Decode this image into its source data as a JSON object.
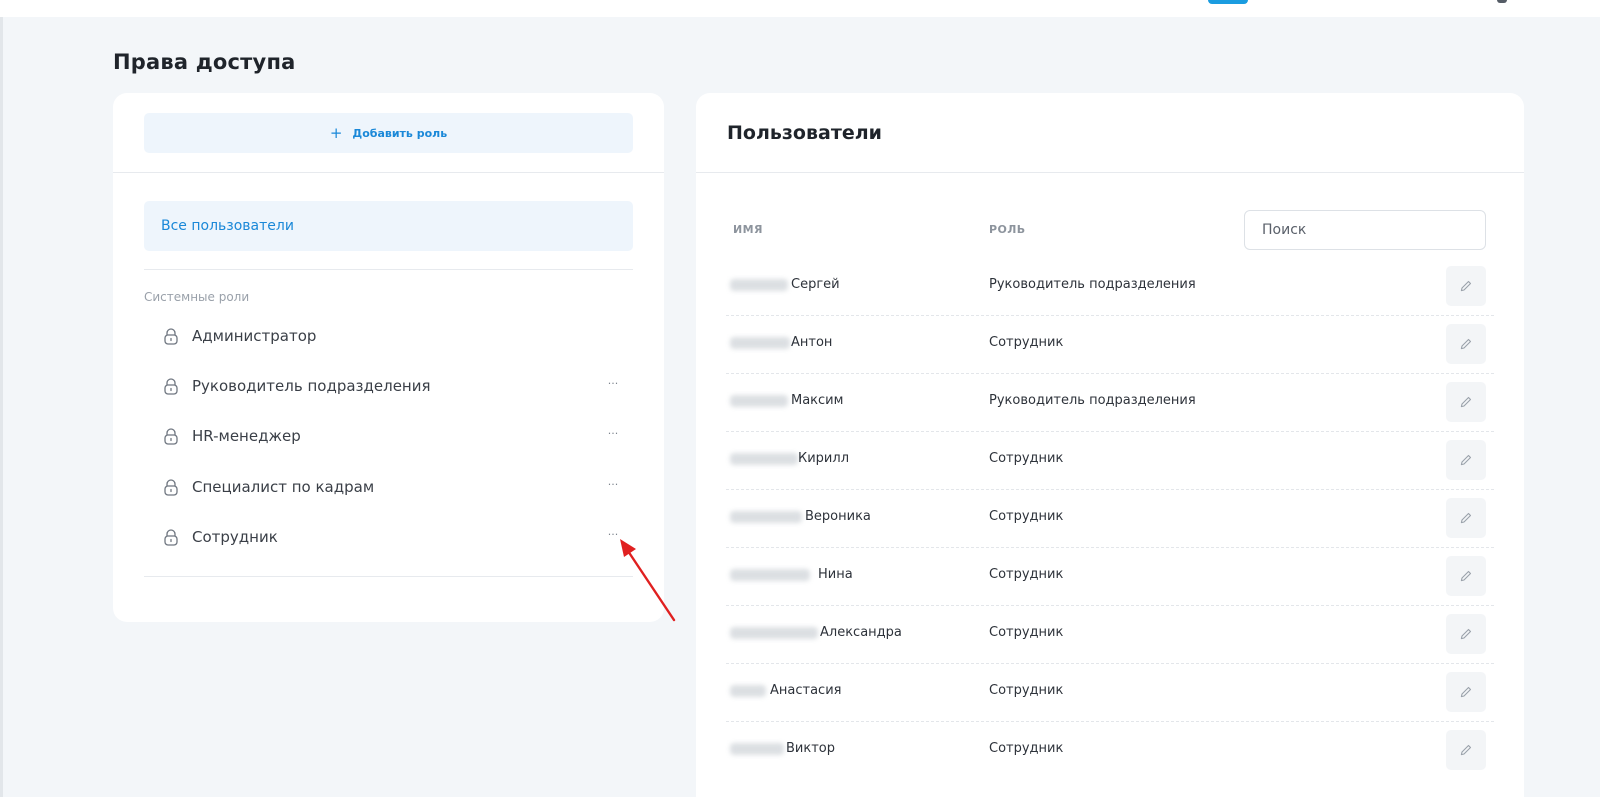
{
  "page": {
    "title": "Права доступа"
  },
  "roles_panel": {
    "add_role_label": "Добавить роль",
    "all_users_label": "Все пользователи",
    "section_label": "Системные роли",
    "roles": [
      {
        "name": "Администратор",
        "has_menu": false
      },
      {
        "name": "Руководитель подразделения",
        "has_menu": true,
        "menu_label": "···"
      },
      {
        "name": "HR-менеджер",
        "has_menu": true,
        "menu_label": "···"
      },
      {
        "name": "Специалист по кадрам",
        "has_menu": true,
        "menu_label": "···"
      },
      {
        "name": "Сотрудник",
        "has_menu": true,
        "menu_label": "···"
      }
    ]
  },
  "users_panel": {
    "title": "Пользователи",
    "columns": {
      "name": "ИМЯ",
      "role": "РОЛЬ"
    },
    "search_placeholder": "Поиск",
    "rows": [
      {
        "name": "Сергей",
        "role": "Руководитель подразделения"
      },
      {
        "name": "Антон",
        "role": "Сотрудник"
      },
      {
        "name": "Максим",
        "role": "Руководитель подразделения"
      },
      {
        "name": "Кирилл",
        "role": "Сотрудник"
      },
      {
        "name": "Вероника",
        "role": "Сотрудник"
      },
      {
        "name": "Нина",
        "role": "Сотрудник"
      },
      {
        "name": "Александра",
        "role": "Сотрудник"
      },
      {
        "name": "Анастасия",
        "role": "Сотрудник"
      },
      {
        "name": "Виктор",
        "role": "Сотрудник"
      }
    ]
  },
  "colors": {
    "accent": "#1a88d8",
    "accent_bg": "#eef5fc",
    "annotation_arrow": "#e02020"
  }
}
